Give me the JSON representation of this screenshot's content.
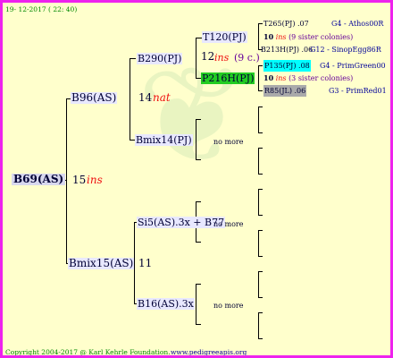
{
  "header": {
    "date": "19- 12-2017 ( 22: 40)"
  },
  "footer": {
    "copyright": "Copyright 2004-2017 @ Karl Kehrle Foundation.",
    "url": "www.pedigreeapis.org"
  },
  "root": {
    "name": "B69(AS)",
    "year": "15",
    "flag": "ins"
  },
  "gen1": [
    {
      "name": "B96(AS)",
      "year": "14",
      "flag": "nat"
    },
    {
      "name": "Bmix15(AS)",
      "year": "11",
      "flag": ""
    }
  ],
  "gen2": [
    {
      "name": "B290(PJ)",
      "year": "12",
      "flag": "ins",
      "extra": "(9 c.)"
    },
    {
      "name": "Bmix14(PJ)",
      "note": "no more"
    },
    {
      "name": "Si5(AS).3x + B77",
      "note": "no more"
    },
    {
      "name": "B16(AS).3x",
      "note": "no more"
    }
  ],
  "gen3": [
    {
      "name": "T120(PJ)"
    },
    {
      "name": "P216H(PJ)",
      "color": "#22cc22"
    }
  ],
  "gen4": [
    {
      "name": "T265(PJ)",
      "suffix": ".07",
      "label": "G4 - Athos00R"
    },
    {
      "year": "10",
      "flag": "ins",
      "note": "(9 sister colonies)"
    },
    {
      "name": "B213H(PJ)",
      "suffix": ".06",
      "label": "G12 - SinopEgg86R"
    },
    {
      "name": "P135(PJ)",
      "suffix": ".08",
      "label": "G4 - PrimGreen00",
      "color": "#00ffff"
    },
    {
      "year": "10",
      "flag": "ins",
      "note": "(3 sister colonies)"
    },
    {
      "name": "R85(JL)",
      "suffix": ".06",
      "label": "G3 - PrimRed01",
      "color": "#aaaaaa"
    }
  ],
  "colors": {
    "border": "#ee22ee",
    "background": "#ffffcc",
    "line": "#000000"
  }
}
